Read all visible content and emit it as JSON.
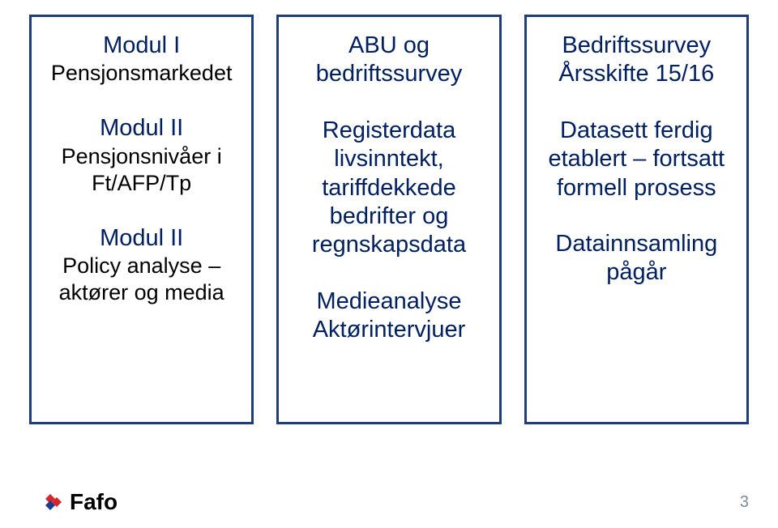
{
  "columns": [
    {
      "blocks": [
        {
          "title": "Modul I",
          "sub": "Pensjonsmarkedet"
        },
        {
          "title": "Modul II",
          "sub": "Pensjonsnivåer i Ft/AFP/Tp"
        },
        {
          "title": "Modul II",
          "sub": "Policy analyse – aktører og media"
        }
      ]
    },
    {
      "blocks": [
        {
          "title": "ABU og bedriftssurvey",
          "sub": ""
        },
        {
          "title": "Registerdata livsinntekt, tariffdekkede bedrifter og regnskapsdata",
          "sub": ""
        },
        {
          "title": "Medieanalyse Aktørintervjuer",
          "sub": ""
        }
      ]
    },
    {
      "blocks": [
        {
          "title": "Bedriftssurvey Årsskifte 15/16",
          "sub": ""
        },
        {
          "title": "Datasett ferdig etablert – fortsatt formell prosess",
          "sub": ""
        },
        {
          "title": "Datainnsamling pågår",
          "sub": ""
        }
      ]
    }
  ],
  "logo": {
    "text": "Fafo"
  },
  "page_number": "3"
}
